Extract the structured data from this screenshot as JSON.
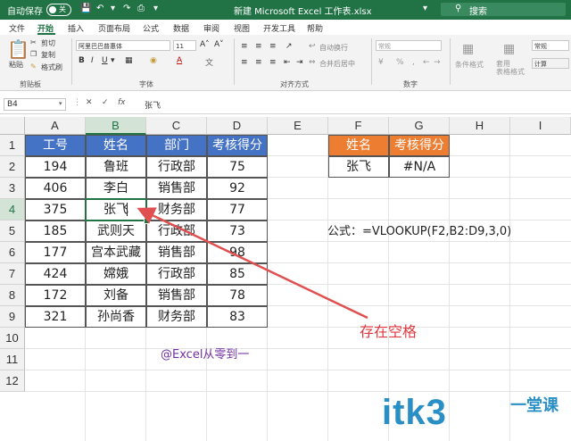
{
  "titlebar": {
    "autosave_label": "自动保存",
    "autosave_state": "关",
    "document_title": "新建 Microsoft Excel 工作表.xlsx",
    "search_placeholder": "搜索",
    "accent": "#217346"
  },
  "tabs": [
    "文件",
    "开始",
    "插入",
    "页面布局",
    "公式",
    "数据",
    "审阅",
    "视图",
    "开发工具",
    "帮助"
  ],
  "active_tab": "开始",
  "ribbon": {
    "clipboard": {
      "paste_label": "粘贴",
      "cut_label": "剪切",
      "copy_label": "复制",
      "format_painter_label": "格式刷",
      "group_label": "剪贴板"
    },
    "font": {
      "font_name": "阿里巴巴普惠体",
      "font_size": "11",
      "group_label": "字体"
    },
    "alignment": {
      "wrap_label": "自动换行",
      "merge_label": "合并后居中",
      "group_label": "对齐方式"
    },
    "number": {
      "format": "常规",
      "group_label": "数字"
    },
    "styles": {
      "conditional_label": "条件格式",
      "table_label": "套用\n表格格式",
      "normal_label": "常规",
      "calc_label": "计算"
    }
  },
  "formula_bar": {
    "name_box": "B4",
    "content": "张飞"
  },
  "columns": [
    "A",
    "B",
    "C",
    "D",
    "E",
    "F",
    "G",
    "H",
    "I"
  ],
  "rows": [
    "1",
    "2",
    "3",
    "4",
    "5",
    "6",
    "7",
    "8",
    "9",
    "10",
    "11",
    "12"
  ],
  "table": {
    "headers": [
      "工号",
      "姓名",
      "部门",
      "考核得分"
    ],
    "rows": [
      [
        "194",
        "鲁班",
        "行政部",
        "75"
      ],
      [
        "406",
        "李白",
        "销售部",
        "92"
      ],
      [
        "375",
        "张飞",
        "财务部",
        "77"
      ],
      [
        "185",
        "武则天",
        "行政部",
        "73"
      ],
      [
        "177",
        "宫本武藏",
        "销售部",
        "98"
      ],
      [
        "424",
        "嫦娥",
        "行政部",
        "85"
      ],
      [
        "172",
        "刘备",
        "销售部",
        "78"
      ],
      [
        "321",
        "孙尚香",
        "财务部",
        "83"
      ]
    ]
  },
  "lookup_table": {
    "headers": [
      "姓名",
      "考核得分"
    ],
    "row": [
      "张飞",
      "#N/A"
    ]
  },
  "annotations": {
    "formula": "公式：=VLOOKUP(F2,B2:D9,3,0)",
    "space_note": "存在空格",
    "credit": "@Excel从零到一",
    "watermark": "itk3",
    "watermark_sub": "一堂课"
  },
  "colors": {
    "table_header": "#4472c4",
    "lookup_header": "#ed7d31",
    "arrow": "#e05050",
    "note": "#e0383e",
    "credit": "#7030a0",
    "watermark": "#2a8fc4"
  }
}
